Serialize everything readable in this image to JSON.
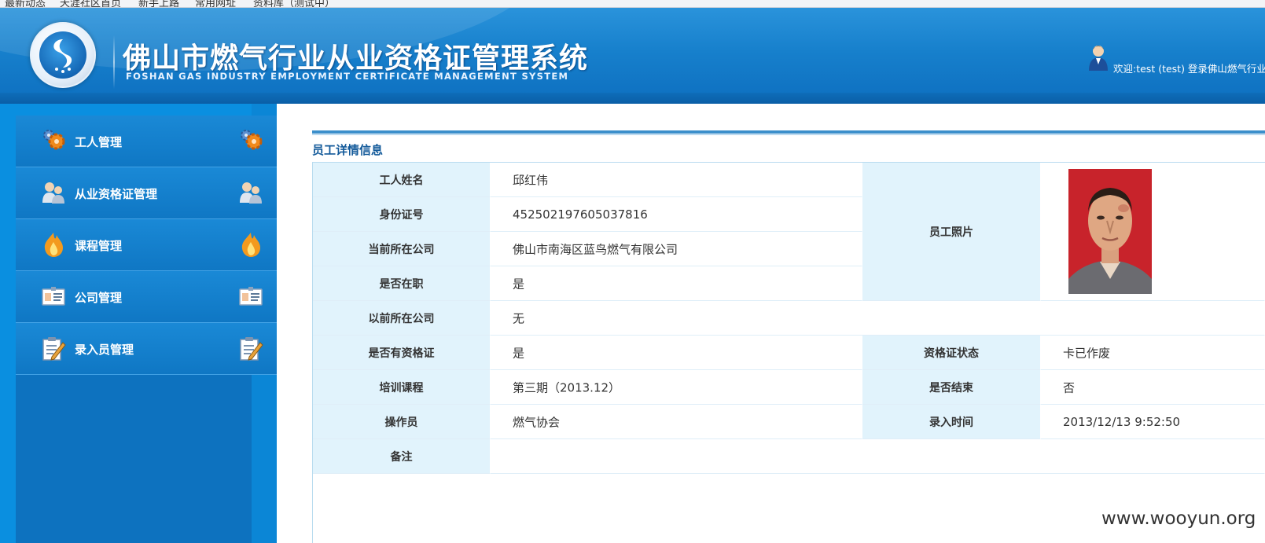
{
  "browser": {
    "bookmarks": [
      "最新动态",
      "天涯社区首页",
      "新手上路",
      "常用网址",
      "资料库（测试中）"
    ]
  },
  "header": {
    "title_cn": "佛山市燃气行业从业资格证管理系统",
    "title_en": "FOSHAN GAS INDUSTRY EMPLOYMENT CERTIFICATE MANAGEMENT SYSTEM",
    "welcome": "欢迎:test (test) 登录佛山燃气行业"
  },
  "sidebar": {
    "items": [
      {
        "label": "工人管理",
        "icon": "gear-icon"
      },
      {
        "label": "从业资格证管理",
        "icon": "users-icon"
      },
      {
        "label": "课程管理",
        "icon": "flame-icon"
      },
      {
        "label": "公司管理",
        "icon": "id-card-icon"
      },
      {
        "label": "录入员管理",
        "icon": "edit-icon"
      }
    ]
  },
  "detail": {
    "title": "员工详情信息",
    "name_label": "工人姓名",
    "name_value": "邱红伟",
    "id_label": "身份证号",
    "id_value": "452502197605037816",
    "company_label": "当前所在公司",
    "company_value": "佛山市南海区蓝鸟燃气有限公司",
    "employed_label": "是否在职",
    "employed_value": "是",
    "prev_company_label": "以前所在公司",
    "prev_company_value": "无",
    "has_cert_label": "是否有资格证",
    "has_cert_value": "是",
    "cert_status_label": "资格证状态",
    "cert_status_value": "卡已作废",
    "course_label": "培训课程",
    "course_value": "第三期（2013.12）",
    "finished_label": "是否结束",
    "finished_value": "否",
    "operator_label": "操作员",
    "operator_value": "燃气协会",
    "entry_time_label": "录入时间",
    "entry_time_value": "2013/12/13 9:52:50",
    "remark_label": "备注",
    "remark_value": "",
    "photo_label": "员工照片"
  },
  "watermark": "www.wooyun.org",
  "colors": {
    "header_blue": "#1780cc",
    "sidebar_blue": "#0d72bf",
    "label_bg": "#e1f3fc",
    "title_blue": "#135a9a"
  }
}
